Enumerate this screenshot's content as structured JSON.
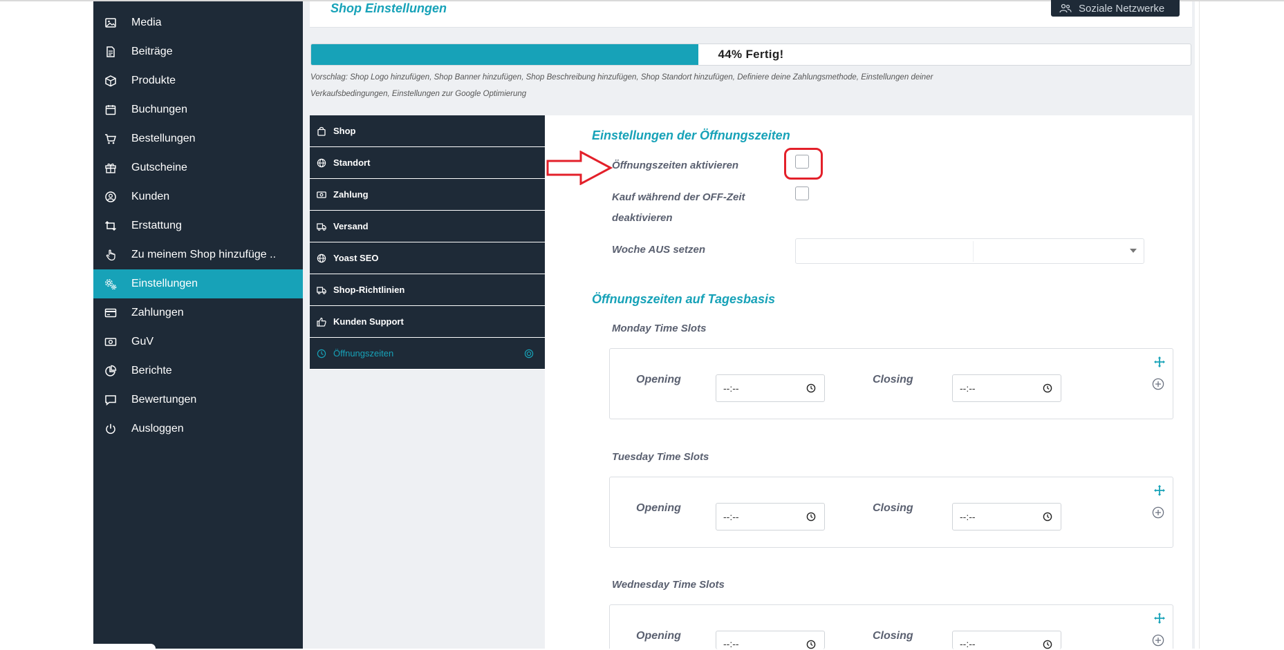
{
  "sidebar": {
    "items": [
      {
        "label": "Media",
        "icon": "image-icon",
        "active": false
      },
      {
        "label": "Beiträge",
        "icon": "document-icon",
        "active": false
      },
      {
        "label": "Produkte",
        "icon": "box-icon",
        "active": false
      },
      {
        "label": "Buchungen",
        "icon": "calendar-icon",
        "active": false
      },
      {
        "label": "Bestellungen",
        "icon": "cart-icon",
        "active": false
      },
      {
        "label": "Gutscheine",
        "icon": "gift-icon",
        "active": false
      },
      {
        "label": "Kunden",
        "icon": "user-circle-icon",
        "active": false
      },
      {
        "label": "Erstattung",
        "icon": "refund-icon",
        "active": false
      },
      {
        "label": "Zu meinem Shop hinzufüge ..",
        "icon": "hand-pointer-icon",
        "active": false
      },
      {
        "label": "Einstellungen",
        "icon": "gears-icon",
        "active": true
      },
      {
        "label": "Zahlungen",
        "icon": "credit-card-icon",
        "active": false
      },
      {
        "label": "GuV",
        "icon": "money-icon",
        "active": false
      },
      {
        "label": "Berichte",
        "icon": "pie-chart-icon",
        "active": false
      },
      {
        "label": "Bewertungen",
        "icon": "comment-icon",
        "active": false
      },
      {
        "label": "Ausloggen",
        "icon": "power-icon",
        "active": false
      }
    ]
  },
  "header": {
    "title": "Shop Einstellungen",
    "social_button": "Soziale Netzwerke"
  },
  "progress": {
    "percent": 44,
    "label": "44% Fertig!"
  },
  "hint": {
    "line1": "Vorschlag: Shop Logo hinzufügen, Shop Banner hinzufügen, Shop Beschreibung hinzufügen, Shop Standort hinzufügen, Definiere deine Zahlungsmethode, Einstellungen deiner",
    "line2": "Verkaufsbedingungen, Einstellungen zur Google Optimierung"
  },
  "settings_nav": {
    "items": [
      {
        "label": "Shop",
        "icon": "bag-icon",
        "active": false
      },
      {
        "label": "Standort",
        "icon": "globe-icon",
        "active": false
      },
      {
        "label": "Zahlung",
        "icon": "money-icon",
        "active": false
      },
      {
        "label": "Versand",
        "icon": "truck-icon",
        "active": false
      },
      {
        "label": "Yoast SEO",
        "icon": "globe-icon",
        "active": false
      },
      {
        "label": "Shop-Richtlinien",
        "icon": "truck-icon",
        "active": false
      },
      {
        "label": "Kunden Support",
        "icon": "thumbs-up-icon",
        "active": false
      },
      {
        "label": "Öffnungszeiten",
        "icon": "clock-icon",
        "active": true
      }
    ]
  },
  "opening_hours": {
    "section_title": "Einstellungen der Öffnungszeiten",
    "enable_label": "Öffnungszeiten aktivieren",
    "enable_checked": false,
    "offtime_label_line1": "Kauf während der OFF-Zeit",
    "offtime_label_line2": "deaktivieren",
    "offtime_checked": false,
    "week_off_label": "Woche AUS setzen",
    "week_off_value": ""
  },
  "daily": {
    "section_title": "Öffnungszeiten auf Tagesbasis",
    "opening_label": "Opening",
    "closing_label": "Closing",
    "days": [
      {
        "label": "Monday Time Slots",
        "opening": "--:--",
        "closing": "--:--"
      },
      {
        "label": "Tuesday Time Slots",
        "opening": "--:--",
        "closing": "--:--"
      },
      {
        "label": "Wednesday Time Slots",
        "opening": "--:--",
        "closing": "--:--"
      }
    ]
  },
  "colors": {
    "accent": "#17a2b8",
    "sidebar_bg": "#1e2a37",
    "annotation_red": "#e3202a"
  }
}
